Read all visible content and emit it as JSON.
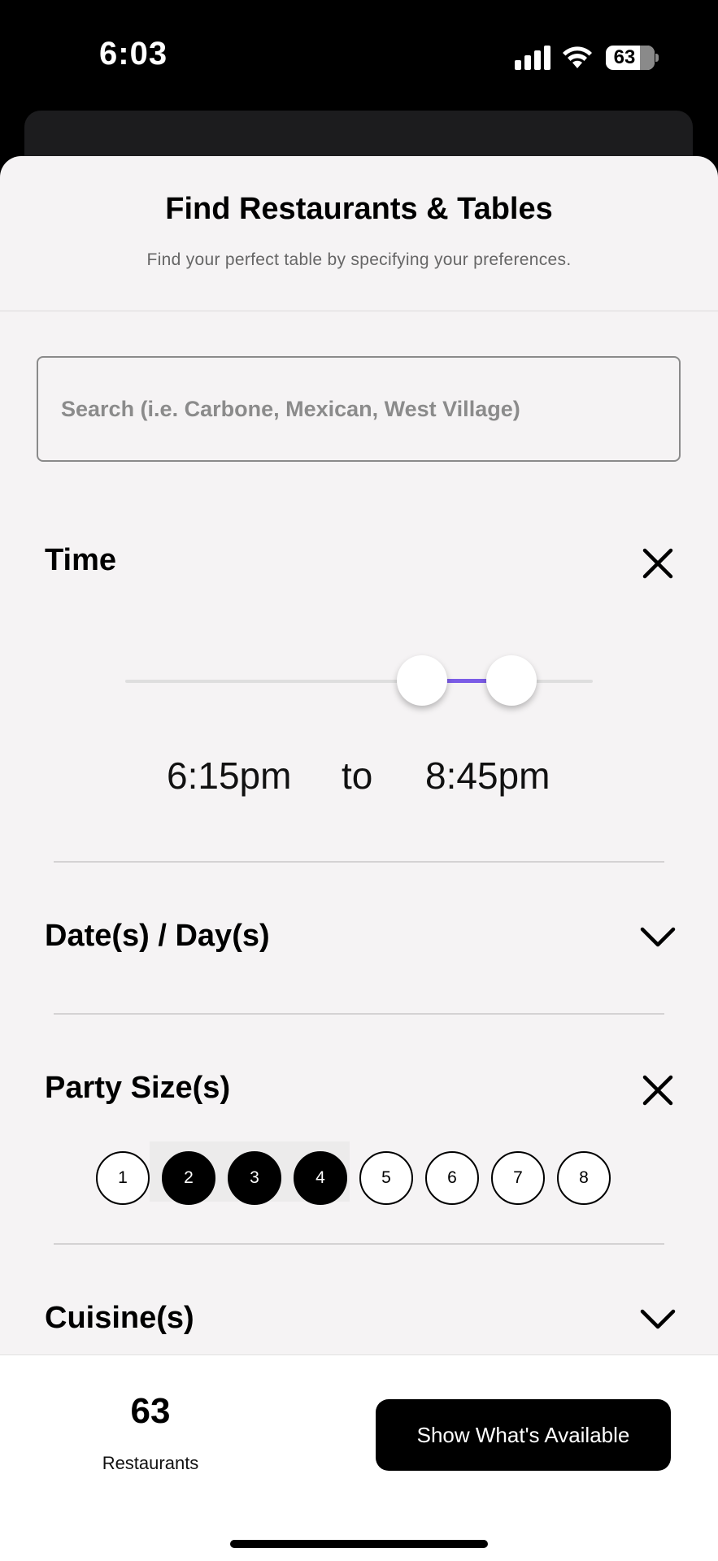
{
  "status_bar": {
    "time": "6:03",
    "battery": "63"
  },
  "sheet": {
    "title": "Find Restaurants & Tables",
    "subtitle": "Find your perfect table by specifying your preferences."
  },
  "search": {
    "placeholder": "Search (i.e. Carbone, Mexican, West Village)",
    "value": ""
  },
  "time_section": {
    "title": "Time",
    "start": "6:15pm",
    "separator": "to",
    "end": "8:45pm",
    "accent_color": "#7b5ce6"
  },
  "dates_section": {
    "title": "Date(s) / Day(s)"
  },
  "party_section": {
    "title": "Party Size(s)",
    "sizes": [
      "1",
      "2",
      "3",
      "4",
      "5",
      "6",
      "7",
      "8"
    ],
    "selected": [
      "2",
      "3",
      "4"
    ]
  },
  "cuisine_section": {
    "title": "Cuisine(s)"
  },
  "footer": {
    "count": "63",
    "count_label": "Restaurants",
    "cta_label": "Show What's Available"
  },
  "icons": {
    "time_clear": "close-icon",
    "dates_toggle": "chevron-down-icon",
    "party_clear": "close-icon",
    "cuisine_toggle": "chevron-down-icon"
  }
}
